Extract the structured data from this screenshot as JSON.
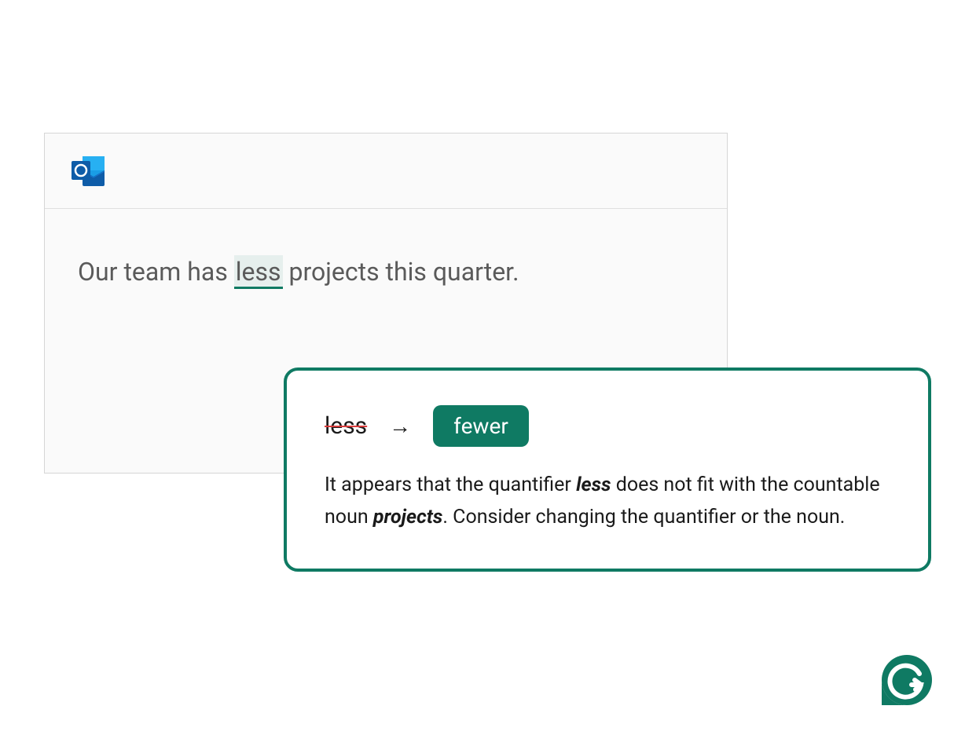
{
  "editor": {
    "text_before": "Our team has ",
    "highlighted": "less",
    "text_after": " projects this quarter."
  },
  "suggestion": {
    "original": "less",
    "replacement": "fewer",
    "arrow": "→",
    "explanation_parts": {
      "p1": "It appears that the quantifier ",
      "em1": "less",
      "p2": " does not fit with the countable noun ",
      "em2": "projects",
      "p3": ". Consider changing the quantifier or the noun."
    }
  },
  "icons": {
    "outlook": "outlook-icon",
    "grammarly": "grammarly-icon"
  },
  "colors": {
    "accent": "#0f7a63",
    "highlight_bg": "#e6efed",
    "strike": "#d93d3d"
  }
}
